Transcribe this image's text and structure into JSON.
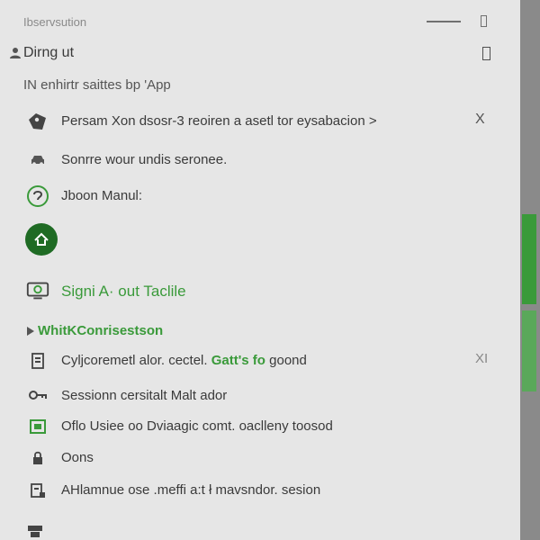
{
  "window": {
    "title": "Ibservsution"
  },
  "account": {
    "label": "Dirng ut"
  },
  "subheading": "IN enhirtr saittes  bp 'App",
  "items": [
    {
      "label": "Persam Xon  dsosr-3 reoiren  a asetl tor eysabacion  >",
      "close": "X"
    },
    {
      "label": "Sonrre wour  undis seronee."
    },
    {
      "label": "Jboon Manul:"
    },
    {
      "label": "Signi A· out Taclile"
    }
  ],
  "section": {
    "heading": "WhitKConrisestson"
  },
  "list": [
    {
      "before": "Cyljcoremetl alor. cectel. ",
      "highlight": "Gatt's fo",
      "after": " goond",
      "close": "XI"
    },
    {
      "label": "Sessionn cersitalt Malt ador"
    },
    {
      "label": "Oflo Usiee oo Dviaagic comt. oaclleny toosod"
    },
    {
      "label": "Oons"
    },
    {
      "label": "AHlamnue ose .meffi a:t  ł mavsndor. sesion"
    }
  ],
  "colors": {
    "accent": "#3a9a3a",
    "dark_accent": "#1f6b24",
    "panel": "#e6e6e6",
    "scrollbar": "#8a8a8a"
  }
}
